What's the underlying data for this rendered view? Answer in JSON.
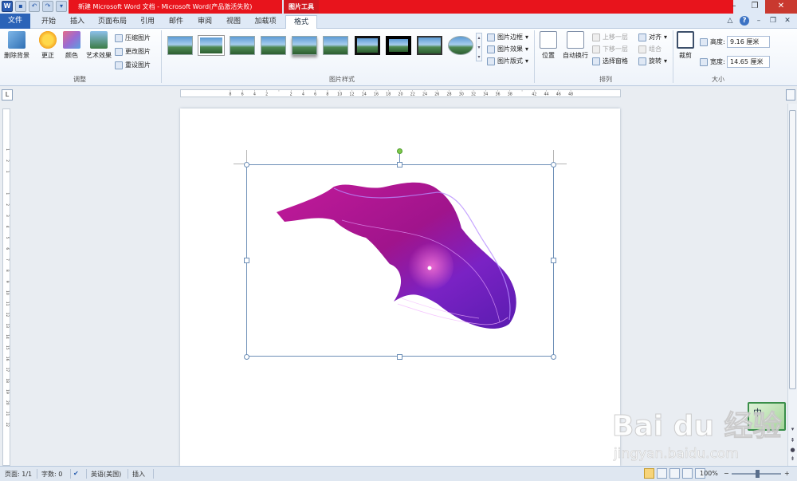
{
  "titlebar": {
    "title": "新建 Microsoft Word 文档 - Microsoft Word(产品激活失败)",
    "context_tab": "图片工具",
    "word_icon": "W"
  },
  "tabs": [
    "文件",
    "开始",
    "插入",
    "页面布局",
    "引用",
    "邮件",
    "审阅",
    "视图",
    "加载项",
    "格式"
  ],
  "ribbon": {
    "adjust": {
      "remove_bg": "删除背景",
      "correct": "更正",
      "color": "颜色",
      "artistic": "艺术效果",
      "compress": "压缩图片",
      "change": "更改图片",
      "reset": "重设图片",
      "label": "调整"
    },
    "styles": {
      "border": "图片边框",
      "effects": "图片效果",
      "layout": "图片版式",
      "label": "图片样式"
    },
    "arrange": {
      "position": "位置",
      "wrap": "自动换行",
      "bring_forward": "上移一层",
      "send_backward": "下移一层",
      "selection_pane": "选择窗格",
      "align": "对齐",
      "group": "组合",
      "rotate": "旋转",
      "label": "排列"
    },
    "size": {
      "crop": "裁剪",
      "height_label": "高度:",
      "height_value": "9.16 厘米",
      "width_label": "宽度:",
      "width_value": "14.65 厘米",
      "label": "大小"
    }
  },
  "ruler": {
    "h_ticks": [
      "8",
      "6",
      "4",
      "2",
      "",
      "2",
      "4",
      "6",
      "8",
      "10",
      "12",
      "14",
      "16",
      "18",
      "20",
      "22",
      "24",
      "26",
      "28",
      "30",
      "32",
      "34",
      "36",
      "38",
      "",
      "42",
      "44",
      "46",
      "48"
    ],
    "v_ticks": [
      "1",
      "2",
      "1",
      "",
      "1",
      "2",
      "3",
      "4",
      "5",
      "6",
      "7",
      "8",
      "9",
      "10",
      "11",
      "12",
      "13",
      "14",
      "15",
      "16",
      "17",
      "18",
      "19",
      "20",
      "21",
      "22"
    ]
  },
  "statusbar": {
    "page": "页面: 1/1",
    "words": "字数: 0",
    "language": "英语(美国)",
    "mode": "插入",
    "zoom": "100%",
    "zoom_level": 0.5
  },
  "ime": {
    "label": "中"
  },
  "watermark": {
    "brand": "Bai du 经验",
    "url": "jingyan.baidu.com"
  },
  "colors": {
    "title_red": "#e8141c",
    "file_tab": "#2b63b8",
    "image_magenta": "#b0128f",
    "image_purple": "#6f1fcc"
  }
}
